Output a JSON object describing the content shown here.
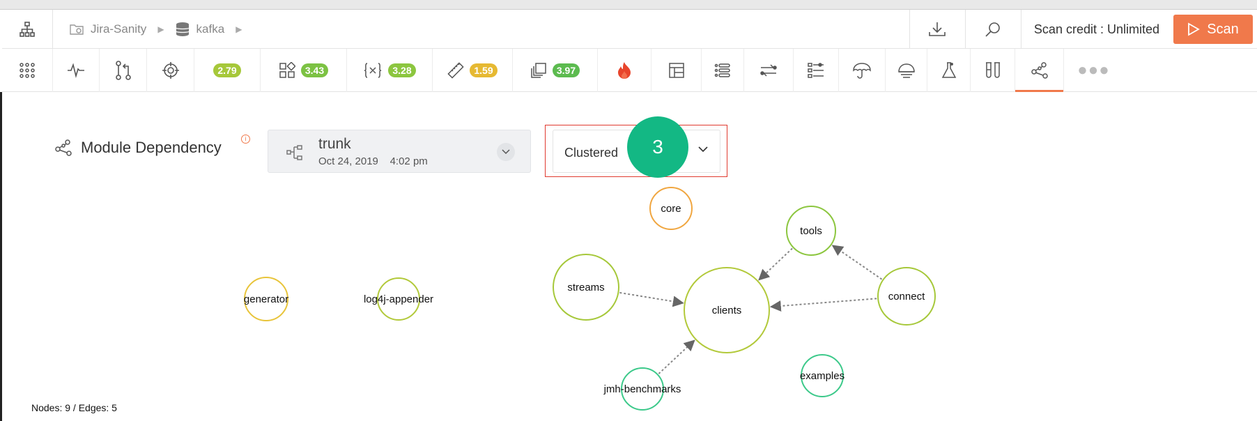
{
  "breadcrumb": {
    "project": "Jira-Sanity",
    "repo": "kafka"
  },
  "topbar": {
    "credit_label": "Scan credit : Unlimited",
    "scan_label": "Scan"
  },
  "toolbar": {
    "metrics": [
      {
        "name": "overall",
        "value": "2.79",
        "color": "#a6c83a"
      },
      {
        "name": "design",
        "value": "3.43",
        "color": "#7cc243"
      },
      {
        "name": "complexity",
        "value": "3.28",
        "color": "#8cc63f"
      },
      {
        "name": "size",
        "value": "1.59",
        "color": "#e6b932"
      },
      {
        "name": "duplication",
        "value": "3.97",
        "color": "#5cbb4f"
      }
    ]
  },
  "module": {
    "title": "Module Dependency",
    "info_glyph": "i",
    "branch_name": "trunk",
    "branch_date": "Oct 24, 2019",
    "branch_time": "4:02 pm",
    "view_mode": "Clustered",
    "step_number": "3"
  },
  "graph": {
    "nodes": [
      {
        "id": "core",
        "label": "core",
        "color": "#f0a640"
      },
      {
        "id": "tools",
        "label": "tools",
        "color": "#8cc63f"
      },
      {
        "id": "streams",
        "label": "streams",
        "color": "#a6c83a"
      },
      {
        "id": "clients",
        "label": "clients",
        "color": "#b2c93a"
      },
      {
        "id": "connect",
        "label": "connect",
        "color": "#a6c83a"
      },
      {
        "id": "generator",
        "label": "generator",
        "color": "#e8c43a"
      },
      {
        "id": "log4j-appender",
        "label": "log4j-appender",
        "color": "#b2c93a"
      },
      {
        "id": "jmh-benchmarks",
        "label": "jmh-benchmarks",
        "color": "#3cc98a"
      },
      {
        "id": "examples",
        "label": "examples",
        "color": "#3cc98a"
      }
    ],
    "edges": [
      {
        "from": "tools",
        "to": "clients"
      },
      {
        "from": "connect",
        "to": "tools"
      },
      {
        "from": "connect",
        "to": "clients"
      },
      {
        "from": "streams",
        "to": "clients"
      },
      {
        "from": "jmh-benchmarks",
        "to": "clients"
      }
    ],
    "stats_label": "Nodes: 9 / Edges: 5"
  }
}
